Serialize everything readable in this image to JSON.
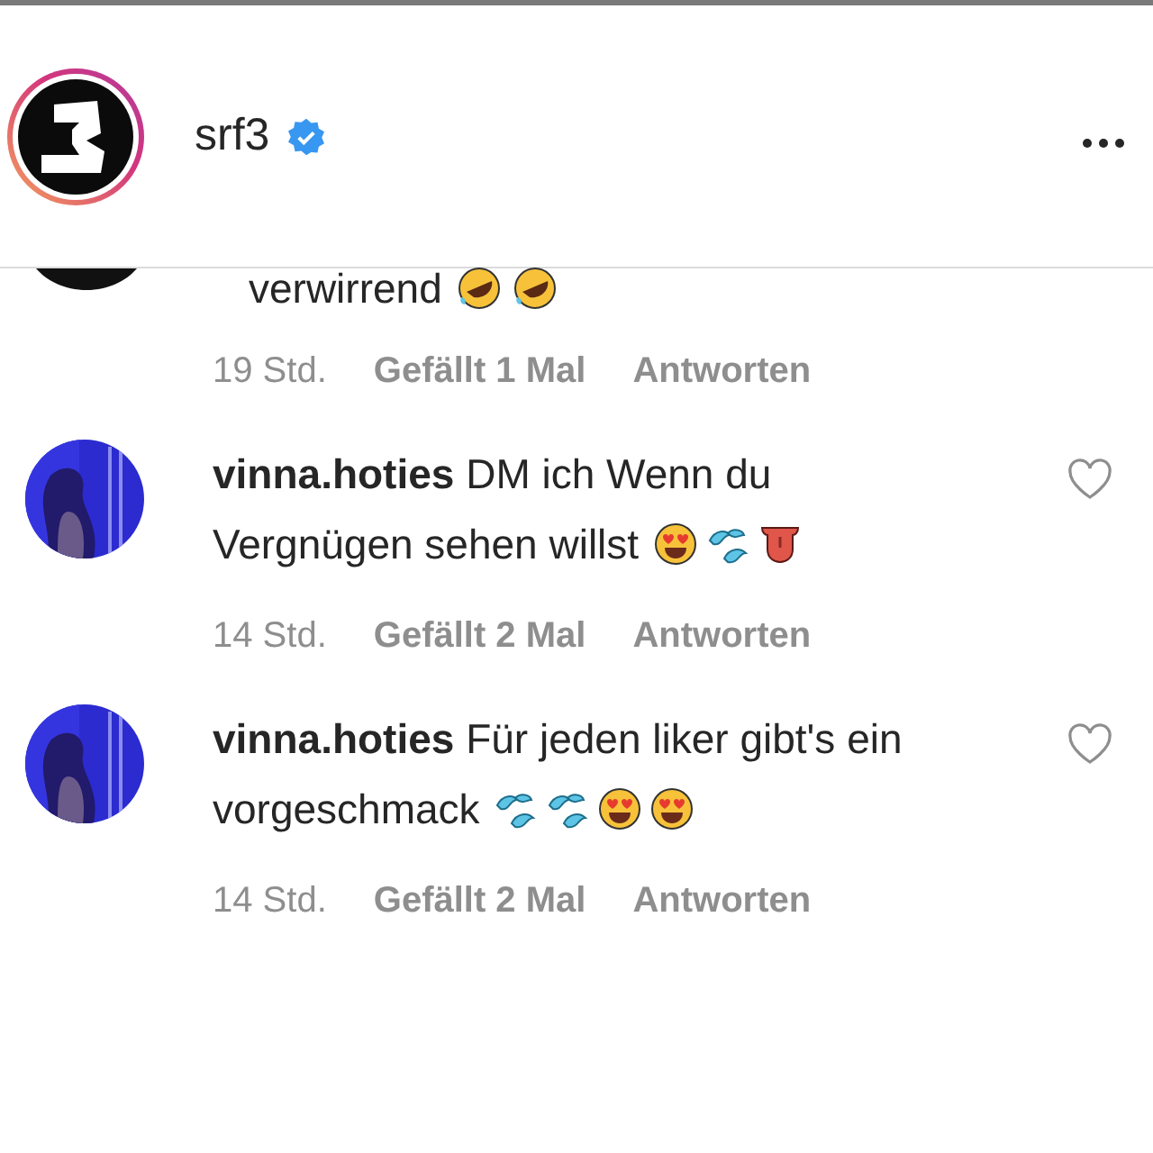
{
  "header": {
    "username": "srf3",
    "verified": true,
    "story_ring": true
  },
  "comments": [
    {
      "kind": "cut_off",
      "text": "verwirrend",
      "emojis": [
        {
          "kind": "rofl"
        },
        {
          "kind": "rofl"
        }
      ],
      "time": "19 Std.",
      "likes": "Gefällt 1 Mal",
      "reply": "Antworten"
    },
    {
      "kind": "full",
      "username": "vinna.hoties",
      "text": "DM ich Wenn du Vergnügen sehen willst",
      "emojis": [
        {
          "kind": "heart_eyes"
        },
        {
          "kind": "sweat_drops"
        },
        {
          "kind": "tongue"
        }
      ],
      "time": "14 Std.",
      "likes": "Gefällt 2 Mal",
      "reply": "Antworten",
      "liked": false
    },
    {
      "kind": "full",
      "username": "vinna.hoties",
      "text": "Für jeden liker gibt's ein vorgeschmack",
      "emojis": [
        {
          "kind": "sweat_drops"
        },
        {
          "kind": "sweat_drops"
        },
        {
          "kind": "heart_eyes"
        },
        {
          "kind": "heart_eyes"
        }
      ],
      "time": "14 Std.",
      "likes": "Gefällt 2 Mal",
      "reply": "Antworten",
      "liked": false
    }
  ]
}
